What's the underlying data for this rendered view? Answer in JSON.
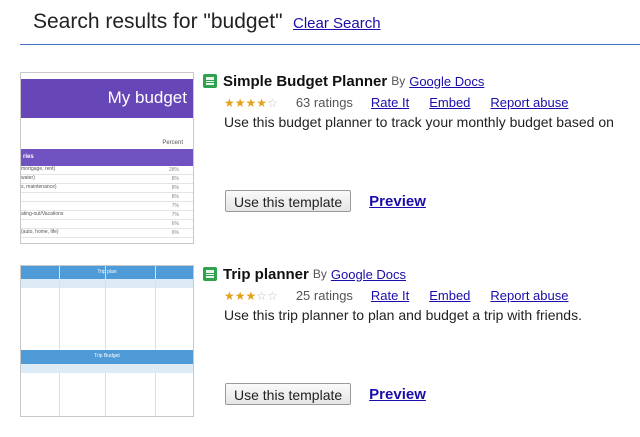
{
  "header": {
    "title": "Search results for \"budget\"",
    "clear_label": "Clear Search"
  },
  "results": [
    {
      "title": "Simple Budget Planner",
      "by": "By",
      "author": "Google Docs",
      "rating_stars": 3.5,
      "ratings_count": "63 ratings",
      "rate_label": "Rate It",
      "embed_label": "Embed",
      "report_label": "Report abuse",
      "description": "Use this budget planner to track your monthly budget based on",
      "use_label": "Use this template",
      "preview_label": "Preview",
      "thumbnail": {
        "banner_text": "My budget",
        "header_label": "Percent",
        "column_label": "ries",
        "rows": [
          {
            "label": "mortgage, rent)",
            "pct": "28%"
          },
          {
            "label": "water)",
            "pct": "8%"
          },
          {
            "label": "s, maintenance)",
            "pct": "8%"
          },
          {
            "label": "",
            "pct": "8%"
          },
          {
            "label": "",
            "pct": "7%"
          },
          {
            "label": "ating-out/Vacations",
            "pct": "7%"
          },
          {
            "label": "",
            "pct": "6%"
          },
          {
            "label": "(auto, home, life)",
            "pct": "6%"
          }
        ]
      }
    },
    {
      "title": "Trip planner",
      "by": "By",
      "author": "Google Docs",
      "rating_stars": 3,
      "ratings_count": "25 ratings",
      "rate_label": "Rate It",
      "embed_label": "Embed",
      "report_label": "Report abuse",
      "description": "Use this trip planner to plan and budget a trip with friends.",
      "use_label": "Use this template",
      "preview_label": "Preview",
      "thumbnail": {
        "plan_title": "Trip plan",
        "budget_title": "Trip Budget"
      }
    }
  ],
  "colors": {
    "accent_link": "#1a0dab",
    "divider": "#4a74c9",
    "star_on": "#e3a21a",
    "budget_banner": "#6746b8",
    "trip_bar": "#4e9bd7"
  }
}
